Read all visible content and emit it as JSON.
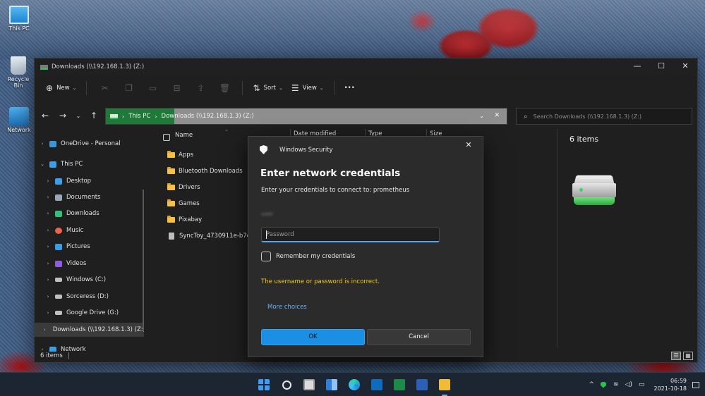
{
  "desktop": {
    "icons": [
      {
        "label": "This PC"
      },
      {
        "label": "Recycle Bin"
      },
      {
        "label": "Network"
      }
    ]
  },
  "window": {
    "title": "Downloads (\\\\192.168.1.3) (Z:)",
    "controls": {
      "minimize": "—",
      "maximize": "☐",
      "close": "✕"
    }
  },
  "toolbar": {
    "new_label": "New",
    "sort_label": "Sort",
    "view_label": "View",
    "more_label": "•••"
  },
  "address": {
    "segments": [
      "This PC",
      "Downloads (\\\\192.168.1.3) (Z:)"
    ],
    "search_placeholder": "Search Downloads (\\\\192.168.1.3) (Z:)"
  },
  "sidebar": {
    "items": [
      {
        "label": "OneDrive - Personal",
        "icon": "cloud-icon",
        "color": "#3a96dd"
      },
      {
        "label": "This PC",
        "icon": "monitor-icon",
        "color": "#3aa0e8"
      },
      {
        "label": "Desktop",
        "icon": "desktop-icon",
        "color": "#3aa0e8"
      },
      {
        "label": "Documents",
        "icon": "documents-icon",
        "color": "#9aa7b8"
      },
      {
        "label": "Downloads",
        "icon": "download-icon",
        "color": "#33c07a"
      },
      {
        "label": "Music",
        "icon": "music-icon",
        "color": "#e8654a"
      },
      {
        "label": "Pictures",
        "icon": "pictures-icon",
        "color": "#3a9de8"
      },
      {
        "label": "Videos",
        "icon": "videos-icon",
        "color": "#8d5ce0"
      },
      {
        "label": "Windows (C:)",
        "icon": "drive-icon",
        "color": "#bfbfbf"
      },
      {
        "label": "Sorceress (D:)",
        "icon": "drive-icon",
        "color": "#bfbfbf"
      },
      {
        "label": "Google Drive (G:)",
        "icon": "drive-icon",
        "color": "#bfbfbf"
      },
      {
        "label": "Downloads (\\\\192.168.1.3) (Z:)",
        "icon": "network-drive-icon",
        "color": "#2fc35a"
      },
      {
        "label": "Network",
        "icon": "network-icon",
        "color": "#3aa0e8"
      }
    ]
  },
  "filelist": {
    "columns": [
      "Name",
      "Date modified",
      "Type",
      "Size"
    ],
    "rows": [
      {
        "name": "Apps"
      },
      {
        "name": "Bluetooth Downloads"
      },
      {
        "name": "Drivers"
      },
      {
        "name": "Games"
      },
      {
        "name": "Pixabay"
      },
      {
        "name": "SyncToy_4730911e-b7c7-4"
      }
    ]
  },
  "details": {
    "count": "6 items"
  },
  "status": {
    "count": "6 items"
  },
  "dialog": {
    "app_name": "Windows Security",
    "title": "Enter network credentials",
    "subtitle": "Enter your credentials to connect to: prometheus",
    "username": "user",
    "password_placeholder": "Password",
    "remember_label": "Remember my credentials",
    "error": "The username or password is incorrect.",
    "more_choices": "More choices",
    "ok_label": "OK",
    "cancel_label": "Cancel",
    "accent": "#1a8fe3",
    "error_color": "#f2c811"
  },
  "taskbar": {
    "time": "06:59",
    "date": "2021-10-18",
    "tray_chevron": "^"
  }
}
